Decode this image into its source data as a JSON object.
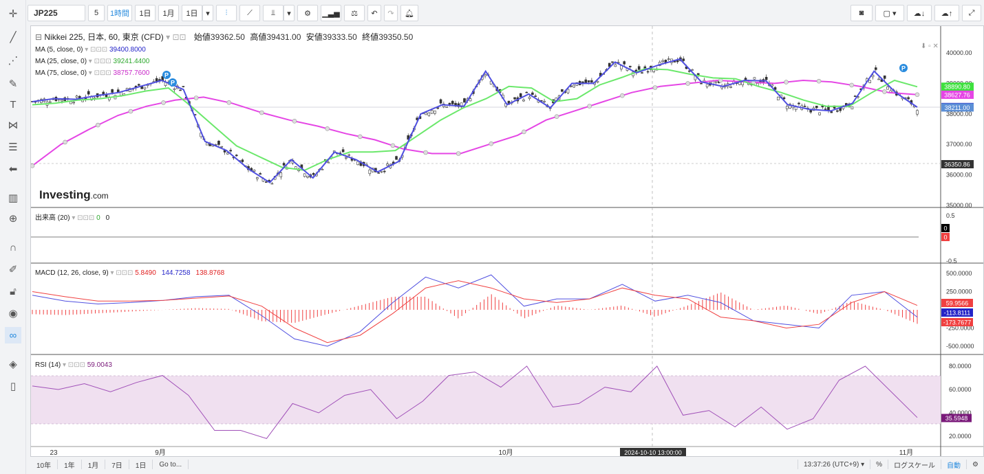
{
  "toolbar": {
    "symbol": "JP225",
    "interval_input": "5",
    "intervals": [
      "1時間",
      "1日",
      "1月",
      "1日"
    ],
    "active_interval": "1時間"
  },
  "bottom": {
    "ranges": [
      "10年",
      "1年",
      "1月",
      "7日",
      "1日",
      "Go to..."
    ],
    "time": "13:37:26 (UTC+9)",
    "percent": "%",
    "log": "ログスケール",
    "auto": "自動"
  },
  "legend": {
    "title": "Nikkei 225, 日本, 60, 東京 (CFD)",
    "open_label": "始値",
    "open": "39362.50",
    "high_label": "高値",
    "high": "39431.00",
    "low_label": "安値",
    "low": "39333.50",
    "close_label": "終値",
    "close": "39350.50",
    "ma5_label": "MA (5, close, 0)",
    "ma5": "39400.8000",
    "ma25_label": "MA (25, close, 0)",
    "ma25": "39241.4400",
    "ma75_label": "MA (75, close, 0)",
    "ma75": "38757.7600",
    "volume_label": "出来高 (20)",
    "volume_a": "0",
    "volume_b": "0",
    "macd_label": "MACD (12, 26, close, 9)",
    "macd_a": "5.8490",
    "macd_b": "144.7258",
    "macd_c": "138.8768",
    "rsi_label": "RSI (14)",
    "rsi": "59.0043",
    "watermark": "Investing",
    "watermark_suffix": ".com"
  },
  "colors": {
    "ma5": "#4f4fe0",
    "ma25": "#6be86b",
    "ma75": "#e546e5",
    "candle": "#333333",
    "macd": "#4f4fe0",
    "signal": "#f04040",
    "hist": "#f04040",
    "rsi": "#a050b8",
    "rsi_band": "#f0e0f0",
    "accent": "#2a8cde"
  },
  "chart_data": {
    "type": "line",
    "price_axis_ticks": [
      "40000.00",
      "39000.00",
      "38000.00",
      "37000.00",
      "36000.00",
      "35000.00"
    ],
    "price_tags": [
      {
        "value": "38890.80",
        "color": "#3ee03e"
      },
      {
        "value": "38627.76",
        "color": "#e546e5"
      },
      {
        "value": "38224.90",
        "color": "#2424c8"
      },
      {
        "value": "38211.00",
        "color": "#5c8fd6"
      },
      {
        "value": "36350.86",
        "color": "#333333"
      }
    ],
    "volume_axis_ticks": [
      "0.5",
      "0",
      "-0.5"
    ],
    "volume_tags": [
      {
        "value": "0",
        "color": "#000000"
      },
      {
        "value": "0",
        "color": "#f04040"
      }
    ],
    "macd_axis_ticks": [
      "500.0000",
      "250.0000",
      "-250.0000",
      "-500.0000"
    ],
    "macd_tags": [
      {
        "value": "59.9566",
        "color": "#f04040"
      },
      {
        "value": "-113.8111",
        "color": "#2424c8"
      },
      {
        "value": "-173.7677",
        "color": "#f04040"
      }
    ],
    "rsi_axis_ticks": [
      "80.0000",
      "60.0000",
      "40.0000",
      "20.0000"
    ],
    "rsi_tag": {
      "value": "35.5948",
      "color": "#7a1a7a"
    },
    "x_labels": [
      "23",
      "9月",
      "10月",
      "11月"
    ],
    "crosshair_label": "2024-10-10 13:00:00",
    "ma5": [
      38400,
      38500,
      38480,
      38600,
      38700,
      38900,
      39100,
      38800,
      37100,
      36800,
      36200,
      35750,
      36500,
      35900,
      36750,
      36500,
      36100,
      36450,
      38000,
      38300,
      38250,
      39400,
      38300,
      38650,
      38200,
      39000,
      39000,
      39700,
      39350,
      39600,
      39800,
      39050,
      38900,
      39100,
      39080,
      38300,
      38150,
      38100,
      38350,
      39400,
      38700,
      38220
    ],
    "ma25": [
      38300,
      38350,
      38450,
      38500,
      38600,
      38750,
      38850,
      38250,
      37600,
      36950,
      36600,
      36250,
      36150,
      36500,
      36750,
      36750,
      36800,
      37300,
      37800,
      38200,
      38500,
      38900,
      38850,
      38400,
      38500,
      38950,
      39200,
      39480,
      39450,
      39300,
      39180,
      39150,
      38900,
      38700,
      38450,
      38250,
      38250,
      38700,
      39100,
      38890
    ],
    "ma75": [
      36300,
      37000,
      37500,
      37950,
      38250,
      38450,
      38550,
      38350,
      38050,
      37800,
      37600,
      37350,
      37150,
      36850,
      36700,
      36700,
      37000,
      37300,
      37800,
      38100,
      38400,
      38700,
      38900,
      39000,
      39100,
      39050,
      39000,
      39100,
      39050,
      38900,
      38700,
      38630
    ],
    "macd": [
      200,
      120,
      80,
      100,
      130,
      180,
      200,
      -80,
      -400,
      -500,
      -300,
      100,
      450,
      300,
      480,
      50,
      150,
      150,
      350,
      120,
      200,
      100,
      -150,
      -200,
      -250,
      200,
      250,
      -100
    ],
    "signal": [
      250,
      180,
      120,
      120,
      130,
      160,
      190,
      50,
      -250,
      -450,
      -350,
      -50,
      300,
      400,
      300,
      150,
      100,
      150,
      300,
      200,
      150,
      -100,
      -150,
      -250,
      -200,
      100,
      250,
      60
    ],
    "rsi": [
      63,
      60,
      65,
      58,
      66,
      72,
      55,
      25,
      25,
      18,
      48,
      40,
      55,
      60,
      35,
      50,
      72,
      75,
      62,
      80,
      45,
      48,
      62,
      58,
      80,
      38,
      42,
      28,
      45,
      26,
      35,
      68,
      80,
      58,
      36
    ]
  }
}
